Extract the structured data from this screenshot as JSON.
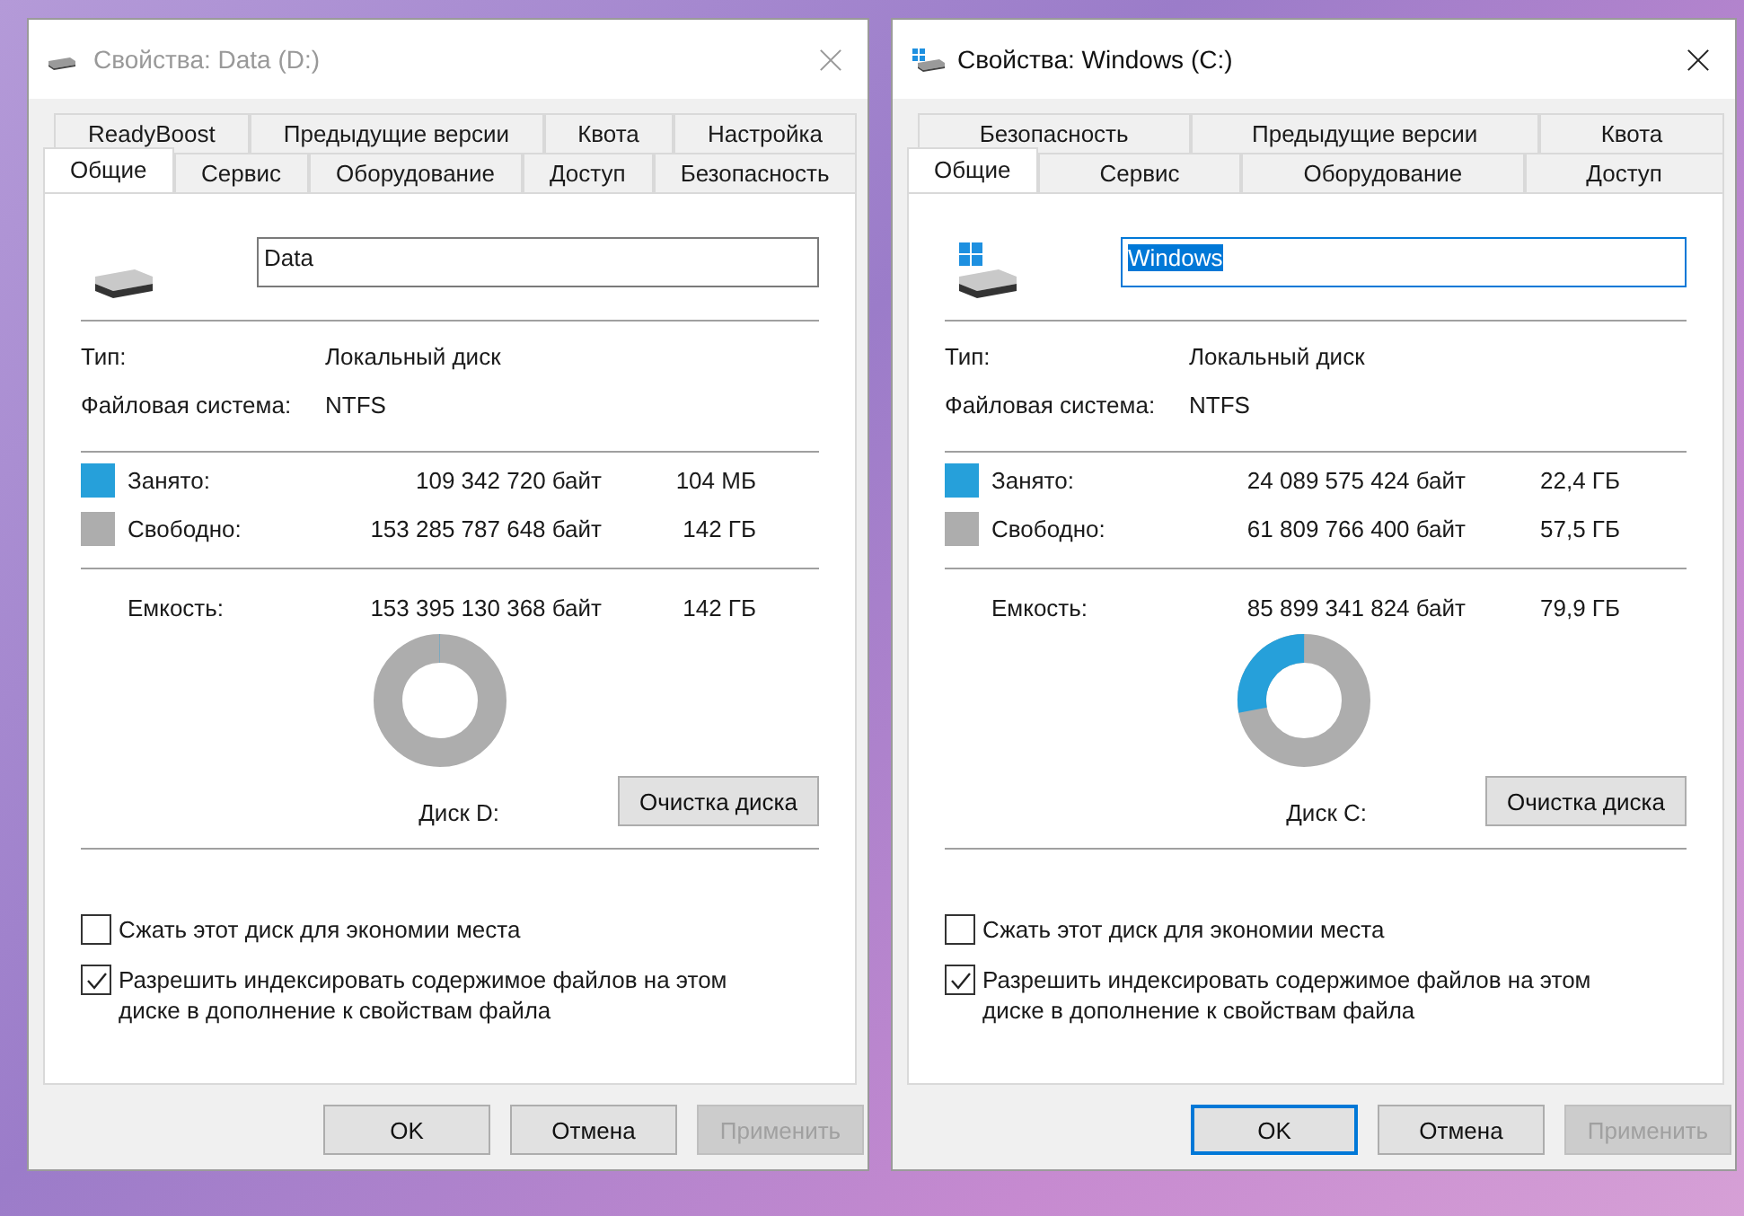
{
  "dialogs": [
    {
      "title": "Свойства: Data (D:)",
      "active": false,
      "system_drive": false,
      "tab_rows": [
        [
          {
            "label": "ReadyBoost",
            "selected": false
          },
          {
            "label": "Предыдущие версии",
            "selected": false
          },
          {
            "label": "Квота",
            "selected": false
          },
          {
            "label": "Настройка",
            "selected": false
          }
        ],
        [
          {
            "label": "Общие",
            "selected": true
          },
          {
            "label": "Сервис",
            "selected": false
          },
          {
            "label": "Оборудование",
            "selected": false
          },
          {
            "label": "Доступ",
            "selected": false
          },
          {
            "label": "Безопасность",
            "selected": false
          }
        ]
      ],
      "name_field": {
        "value": "Data",
        "text_selected": false
      },
      "info": [
        {
          "label": "Тип:",
          "value": "Локальный диск"
        },
        {
          "label": "Файловая система:",
          "value": "NTFS"
        }
      ],
      "usage": [
        {
          "label": "Занято:",
          "bytes": "109 342 720 байт",
          "size": "104 МБ",
          "color": "#26a0da"
        },
        {
          "label": "Свободно:",
          "bytes": "153 285 787 648 байт",
          "size": "142 ГБ",
          "color": "#adadad"
        }
      ],
      "capacity": {
        "label": "Емкость:",
        "bytes": "153 395 130 368 байт",
        "size": "142 ГБ"
      },
      "donut": {
        "level": 0.001
      },
      "disk_label": "Диск D:",
      "cleanup_button": "Очистка диска",
      "checkboxes": [
        {
          "label": "Сжать этот диск для экономии места",
          "checked": false
        },
        {
          "label": "Разрешить индексировать содержимое файлов на этом диске в дополнение к свойствам файла",
          "checked": true
        }
      ],
      "buttons": [
        {
          "label": "OK",
          "default": false,
          "disabled": false
        },
        {
          "label": "Отмена",
          "default": false,
          "disabled": false
        },
        {
          "label": "Применить",
          "default": false,
          "disabled": true
        }
      ]
    },
    {
      "title": "Свойства: Windows (C:)",
      "active": true,
      "system_drive": true,
      "tab_rows": [
        [
          {
            "label": "Безопасность",
            "selected": false
          },
          {
            "label": "Предыдущие версии",
            "selected": false
          },
          {
            "label": "Квота",
            "selected": false
          }
        ],
        [
          {
            "label": "Общие",
            "selected": true
          },
          {
            "label": "Сервис",
            "selected": false
          },
          {
            "label": "Оборудование",
            "selected": false
          },
          {
            "label": "Доступ",
            "selected": false
          }
        ]
      ],
      "name_field": {
        "value": "Windows",
        "text_selected": true
      },
      "info": [
        {
          "label": "Тип:",
          "value": "Локальный диск"
        },
        {
          "label": "Файловая система:",
          "value": "NTFS"
        }
      ],
      "usage": [
        {
          "label": "Занято:",
          "bytes": "24 089 575 424 байт",
          "size": "22,4 ГБ",
          "color": "#26a0da"
        },
        {
          "label": "Свободно:",
          "bytes": "61 809 766 400 байт",
          "size": "57,5 ГБ",
          "color": "#adadad"
        }
      ],
      "capacity": {
        "label": "Емкость:",
        "bytes": "85 899 341 824 байт",
        "size": "79,9 ГБ"
      },
      "donut": {
        "level": 0.28
      },
      "disk_label": "Диск C:",
      "cleanup_button": "Очистка диска",
      "checkboxes": [
        {
          "label": "Сжать этот диск для экономии места",
          "checked": false
        },
        {
          "label": "Разрешить индексировать содержимое файлов на этом диске в дополнение к свойствам файла",
          "checked": true
        }
      ],
      "buttons": [
        {
          "label": "OK",
          "default": true,
          "disabled": false
        },
        {
          "label": "Отмена",
          "default": false,
          "disabled": false
        },
        {
          "label": "Применить",
          "default": false,
          "disabled": true
        }
      ]
    }
  ]
}
